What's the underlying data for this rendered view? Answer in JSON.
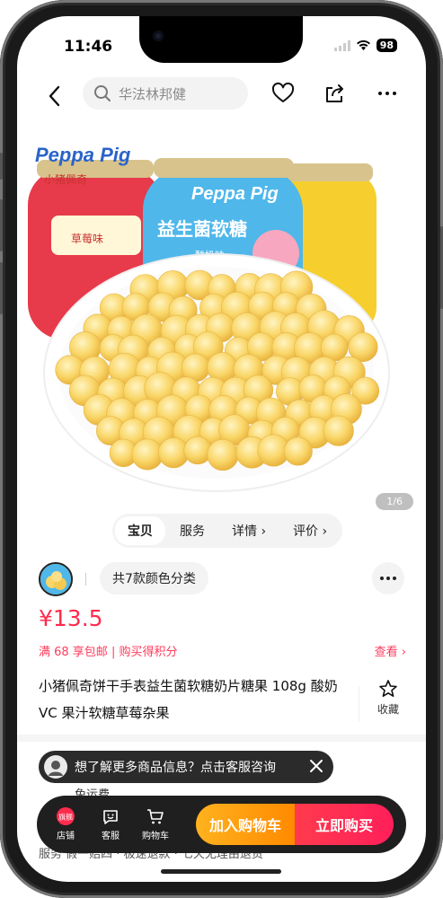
{
  "status": {
    "time": "11:46",
    "battery": "98"
  },
  "nav": {
    "search_placeholder": "华法林邦健"
  },
  "hero": {
    "brand": "Peppa Pig",
    "brand_cn": "小猪佩奇",
    "jar_label": "益生菌软糖",
    "flavors": [
      "草莓味",
      "酸奶味"
    ],
    "page_indicator": "1/6"
  },
  "tabs": [
    "宝贝",
    "服务",
    "详情 ›",
    "评价 ›"
  ],
  "sku": {
    "label": "共7款颜色分类"
  },
  "price": "¥13.5",
  "promo": "满 68 享包邮 | 购买得积分",
  "check": "查看 ›",
  "title": "小猪佩奇饼干手表益生菌软糖奶片糖果 108g 酸奶 VC 果汁软糖草莓杂果",
  "favorite_label": "收藏",
  "tooltip": "想了解更多商品信息？点击客服咨询",
  "shipping": "免运费",
  "service": "服务   假一赔四 · 极速退款 · 七天无理由退货",
  "bottom_bar": {
    "store_badge": "旗舰",
    "store": "店铺",
    "service": "客服",
    "cart": "购物车",
    "add_to_cart": "加入购物车",
    "buy_now": "立即购买"
  },
  "colors": {
    "accent": "#ff2b4d",
    "cart": "#ff9a00",
    "buy": "#ff2b55"
  }
}
